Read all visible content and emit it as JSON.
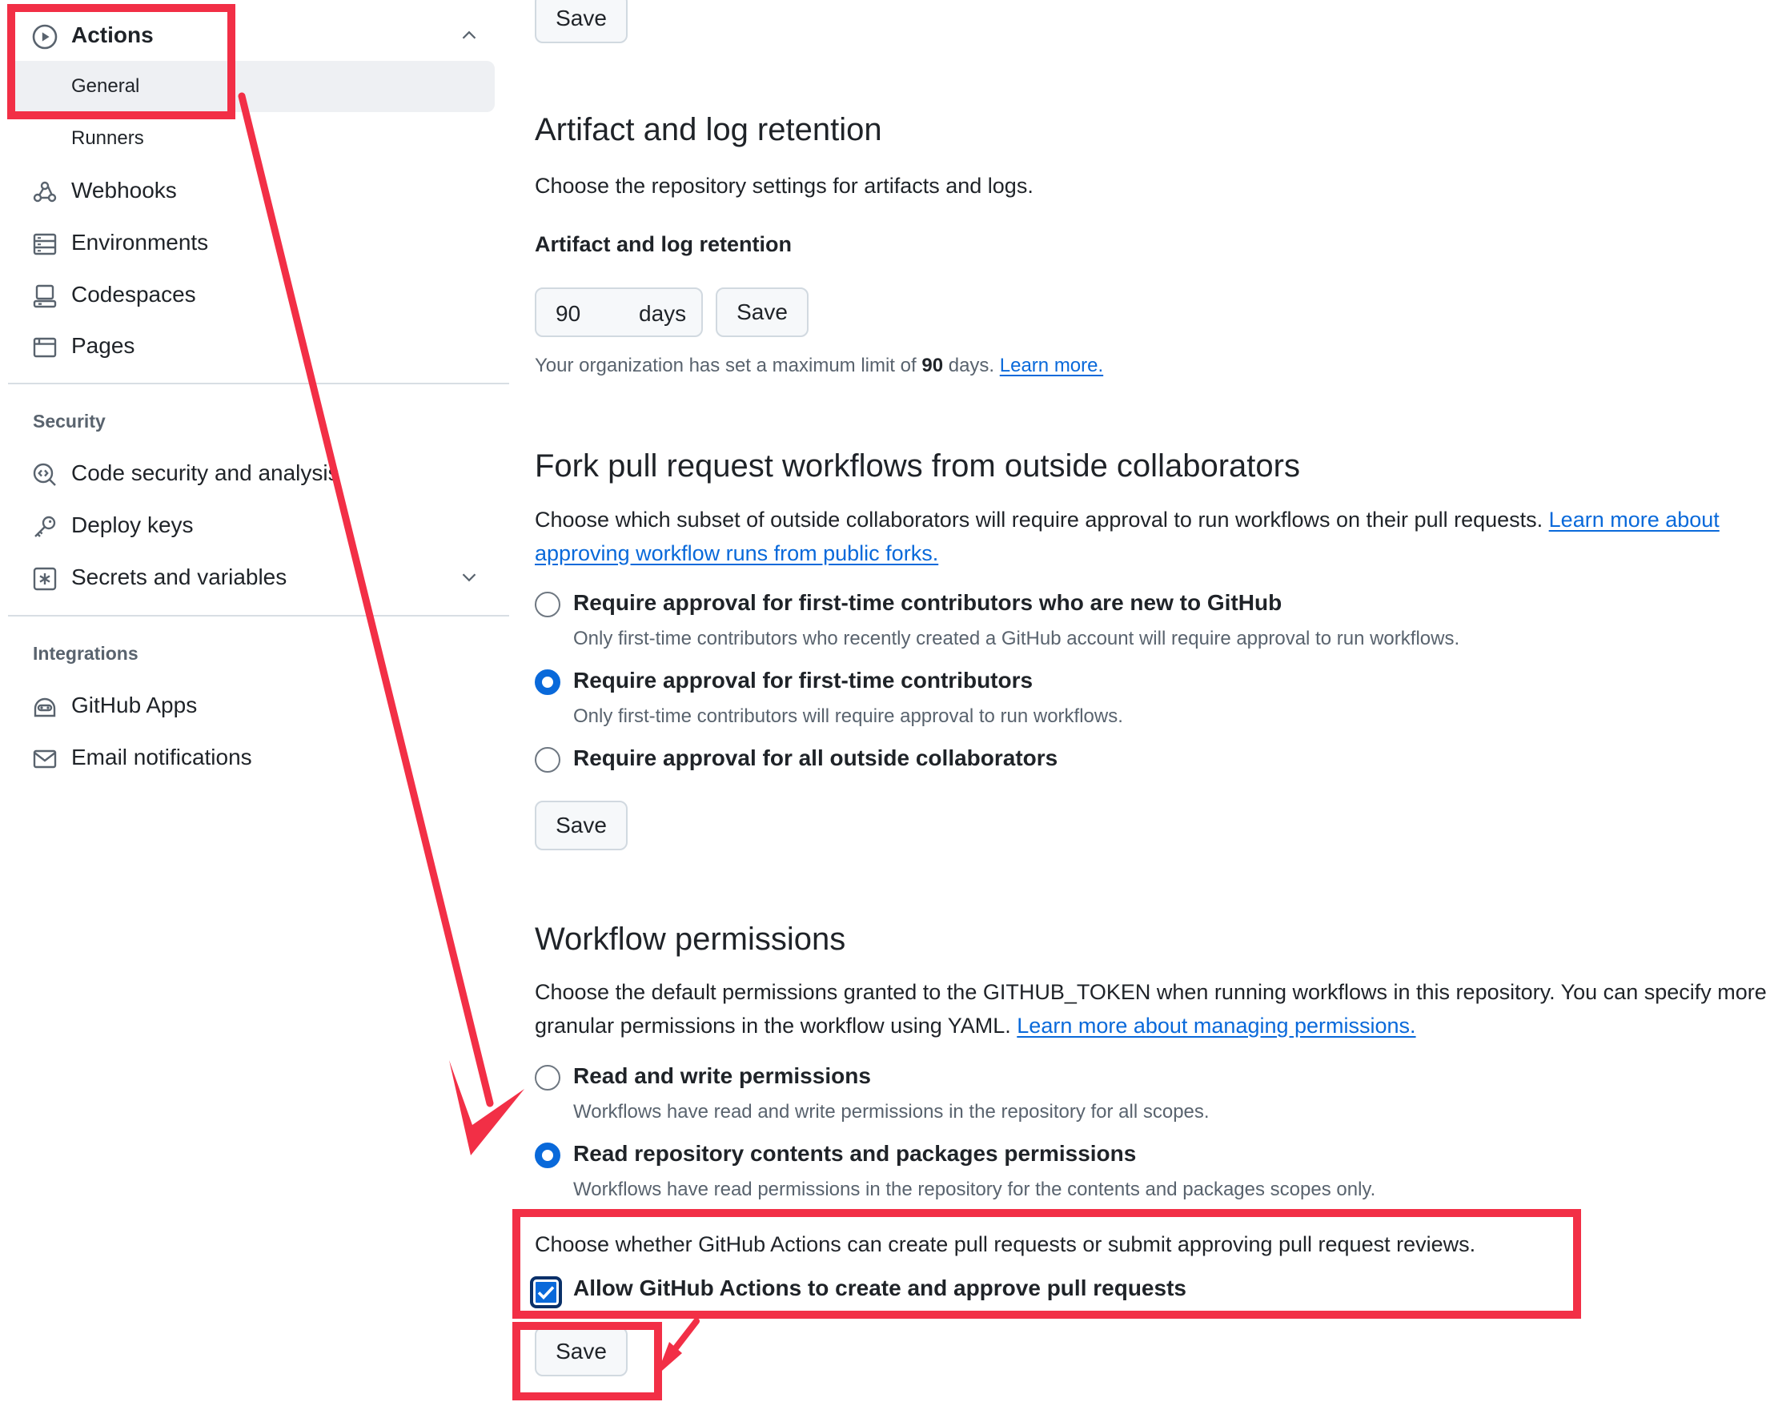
{
  "sidebar": {
    "actions": {
      "label": "Actions",
      "icon": "play-circle-icon"
    },
    "actions_sub": [
      {
        "label": "General",
        "active": true
      },
      {
        "label": "Runners"
      }
    ],
    "items": [
      {
        "label": "Webhooks",
        "icon": "webhook-icon"
      },
      {
        "label": "Environments",
        "icon": "server-icon"
      },
      {
        "label": "Codespaces",
        "icon": "codespaces-icon"
      },
      {
        "label": "Pages",
        "icon": "browser-icon"
      }
    ],
    "security_heading": "Security",
    "security_items": [
      {
        "label": "Code security and analysis",
        "icon": "codescan-icon"
      },
      {
        "label": "Deploy keys",
        "icon": "key-icon"
      },
      {
        "label": "Secrets and variables",
        "icon": "asterisk-box-icon"
      }
    ],
    "integrations_heading": "Integrations",
    "integrations_items": [
      {
        "label": "GitHub Apps",
        "icon": "hubot-icon"
      },
      {
        "label": "Email notifications",
        "icon": "mail-icon"
      }
    ]
  },
  "main": {
    "top_save": "Save",
    "retention": {
      "title": "Artifact and log retention",
      "description": "Choose the repository settings for artifacts and logs.",
      "field_label": "Artifact and log retention",
      "value": "90",
      "unit": "days",
      "save": "Save",
      "note_prefix": "Your organization has set a maximum limit of",
      "note_value": "90",
      "note_suffix": "days.",
      "note_link": "Learn more."
    },
    "fork": {
      "title": "Fork pull request workflows from outside collaborators",
      "description": "Choose which subset of outside collaborators will require approval to run workflows on their pull requests.",
      "link": "Learn more about approving workflow runs from public forks.",
      "options": [
        {
          "label": "Require approval for first-time contributors who are new to GitHub",
          "desc": "Only first-time contributors who recently created a GitHub account will require approval to run workflows.",
          "selected": false
        },
        {
          "label": "Require approval for first-time contributors",
          "desc": "Only first-time contributors will require approval to run workflows.",
          "selected": true
        },
        {
          "label": "Require approval for all outside collaborators",
          "desc": "",
          "selected": false
        }
      ],
      "save": "Save"
    },
    "workflow": {
      "title": "Workflow permissions",
      "description": "Choose the default permissions granted to the GITHUB_TOKEN when running workflows in this repository. You can specify more granular permissions in the workflow using YAML.",
      "link": "Learn more about managing permissions.",
      "options": [
        {
          "label": "Read and write permissions",
          "desc": "Workflows have read and write permissions in the repository for all scopes.",
          "selected": false
        },
        {
          "label": "Read repository contents and packages permissions",
          "desc": "Workflows have read permissions in the repository for the contents and packages scopes only.",
          "selected": true
        }
      ],
      "pr_text": "Choose whether GitHub Actions can create pull requests or submit approving pull request reviews.",
      "pr_checkbox_label": "Allow GitHub Actions to create and approve pull requests",
      "pr_checked": true,
      "save": "Save"
    }
  },
  "colors": {
    "annotation": "#f22f46",
    "accent": "#0969da"
  }
}
